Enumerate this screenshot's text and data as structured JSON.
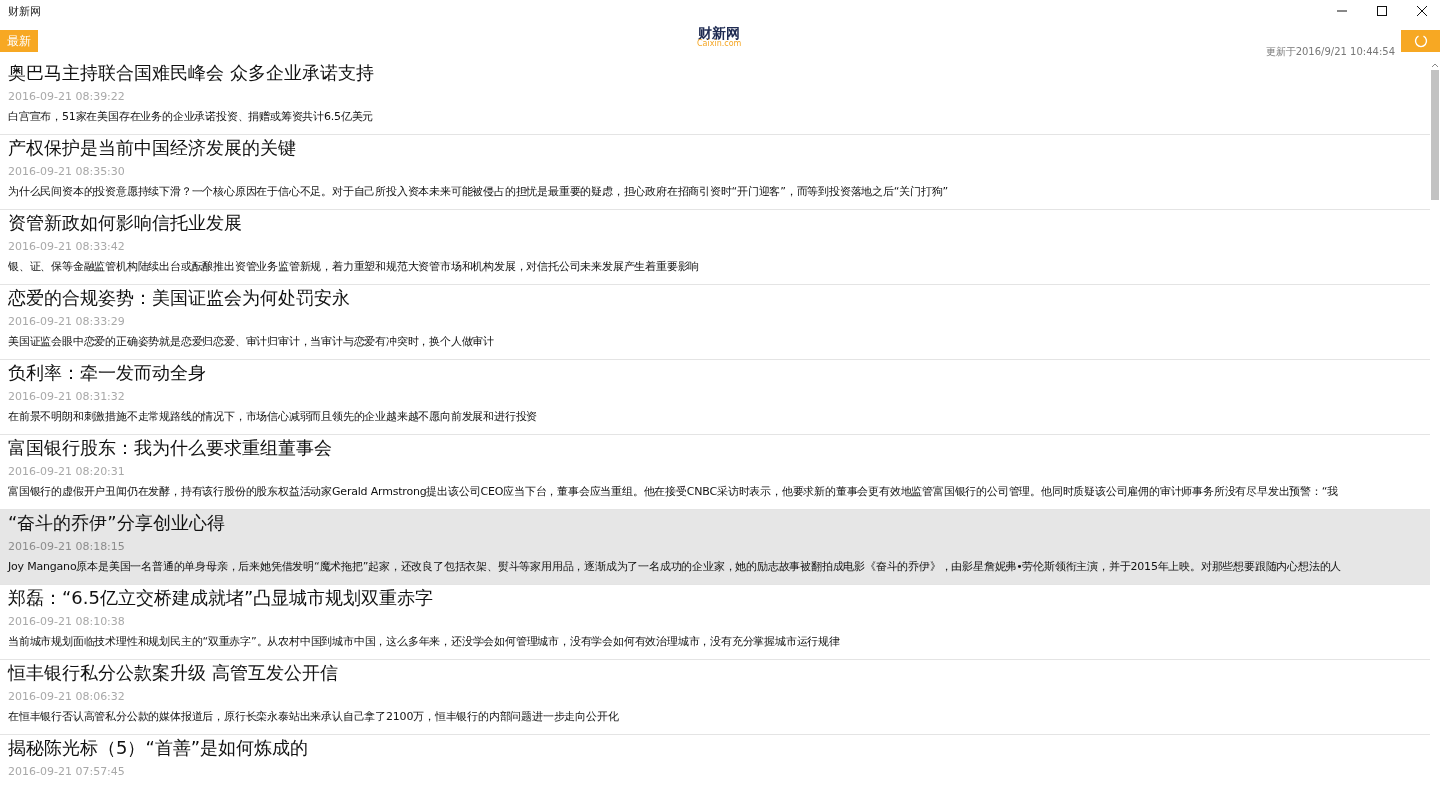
{
  "window": {
    "title": "财新网"
  },
  "header": {
    "category_button": "最新",
    "logo": {
      "name": "财新网",
      "domain": "Caixin.com"
    },
    "updated": "更新于2016/9/21 10:44:54"
  },
  "articles": [
    {
      "title": "奥巴马主持联合国难民峰会 众多企业承诺支持",
      "time": "2016-09-21 08:39:22",
      "summary": "白宫宣布，51家在美国存在业务的企业承诺投资、捐赠或筹资共计6.5亿美元",
      "selected": false
    },
    {
      "title": "产权保护是当前中国经济发展的关键",
      "time": "2016-09-21 08:35:30",
      "summary": "为什么民间资本的投资意愿持续下滑？一个核心原因在于信心不足。对于自己所投入资本未来可能被侵占的担忧是最重要的疑虑，担心政府在招商引资时“开门迎客”，而等到投资落地之后“关门打狗”",
      "selected": false
    },
    {
      "title": "资管新政如何影响信托业发展",
      "time": "2016-09-21 08:33:42",
      "summary": "银、证、保等金融监管机构陆续出台或酝酿推出资管业务监管新规，着力重塑和规范大资管市场和机构发展，对信托公司未来发展产生着重要影响",
      "selected": false
    },
    {
      "title": "恋爱的合规姿势：美国证监会为何处罚安永",
      "time": "2016-09-21 08:33:29",
      "summary": "美国证监会眼中恋爱的正确姿势就是恋爱归恋爱、审计归审计，当审计与恋爱有冲突时，换个人做审计",
      "selected": false
    },
    {
      "title": "负利率：牵一发而动全身",
      "time": "2016-09-21 08:31:32",
      "summary": "在前景不明朗和刺激措施不走常规路线的情况下，市场信心减弱而且领先的企业越来越不愿向前发展和进行投资",
      "selected": false
    },
    {
      "title": "富国银行股东：我为什么要求重组董事会",
      "time": "2016-09-21 08:20:31",
      "summary": "富国银行的虚假开户丑闻仍在发酵，持有该行股份的股东权益活动家Gerald Armstrong提出该公司CEO应当下台，董事会应当重组。他在接受CNBC采访时表示，他要求新的董事会更有效地监管富国银行的公司管理。他同时质疑该公司雇佣的审计师事务所没有尽早发出预警：“我",
      "selected": false
    },
    {
      "title": "“奋斗的乔伊”分享创业心得",
      "time": "2016-09-21 08:18:15",
      "summary": "Joy Mangano原本是美国一名普通的单身母亲，后来她凭借发明“魔术拖把”起家，还改良了包括衣架、熨斗等家用用品，逐渐成为了一名成功的企业家，她的励志故事被翻拍成电影《奋斗的乔伊》，由影星詹妮弗•劳伦斯领衔主演，并于2015年上映。对那些想要跟随内心想法的人",
      "selected": true
    },
    {
      "title": "郑磊：“6.5亿立交桥建成就堵”凸显城市规划双重赤字",
      "time": "2016-09-21 08:10:38",
      "summary": "当前城市规划面临技术理性和规划民主的“双重赤字”。从农村中国到城市中国，这么多年来，还没学会如何管理城市，没有学会如何有效治理城市，没有充分掌握城市运行规律",
      "selected": false
    },
    {
      "title": "恒丰银行私分公款案升级 高管互发公开信",
      "time": "2016-09-21 08:06:32",
      "summary": "在恒丰银行否认高管私分公款的媒体报道后，原行长栾永泰站出来承认自己拿了2100万，恒丰银行的内部问题进一步走向公开化",
      "selected": false
    },
    {
      "title": "揭秘陈光标（5）“首善”是如何炼成的",
      "time": "2016-09-21 07:57:45",
      "selected": false
    }
  ]
}
